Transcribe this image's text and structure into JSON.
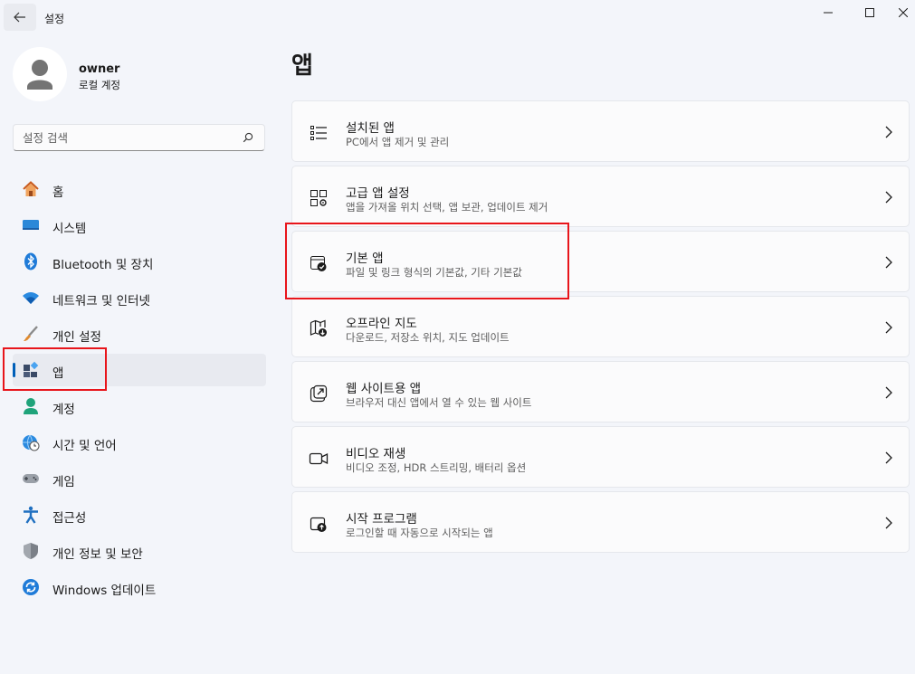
{
  "window": {
    "title": "설정"
  },
  "profile": {
    "name": "owner",
    "account_type": "로컬 계정"
  },
  "search": {
    "placeholder": "설정 검색"
  },
  "sidebar": {
    "items": [
      {
        "label": "홈",
        "icon": "home-icon"
      },
      {
        "label": "시스템",
        "icon": "system-icon"
      },
      {
        "label": "Bluetooth 및 장치",
        "icon": "bluetooth-icon"
      },
      {
        "label": "네트워크 및 인터넷",
        "icon": "wifi-icon"
      },
      {
        "label": "개인 설정",
        "icon": "brush-icon"
      },
      {
        "label": "앱",
        "icon": "apps-icon",
        "selected": true
      },
      {
        "label": "계정",
        "icon": "account-icon"
      },
      {
        "label": "시간 및 언어",
        "icon": "globe-clock-icon"
      },
      {
        "label": "게임",
        "icon": "gamepad-icon"
      },
      {
        "label": "접근성",
        "icon": "accessibility-icon"
      },
      {
        "label": "개인 정보 및 보안",
        "icon": "shield-icon"
      },
      {
        "label": "Windows 업데이트",
        "icon": "update-icon"
      }
    ]
  },
  "main": {
    "title": "앱",
    "cards": [
      {
        "title": "설치된 앱",
        "subtitle": "PC에서 앱 제거 및 관리",
        "icon": "list-icon"
      },
      {
        "title": "고급 앱 설정",
        "subtitle": "앱을 가져올 위치 선택, 앱 보관, 업데이트 제거",
        "icon": "advanced-apps-icon"
      },
      {
        "title": "기본 앱",
        "subtitle": "파일 및 링크 형식의 기본값, 기타 기본값",
        "icon": "default-apps-icon"
      },
      {
        "title": "오프라인 지도",
        "subtitle": "다운로드, 저장소 위치, 지도 업데이트",
        "icon": "offline-map-icon"
      },
      {
        "title": "웹 사이트용 앱",
        "subtitle": "브라우저 대신 앱에서 열 수 있는 웹 사이트",
        "icon": "web-app-icon"
      },
      {
        "title": "비디오 재생",
        "subtitle": "비디오 조정, HDR 스트리밍, 배터리 옵션",
        "icon": "video-icon"
      },
      {
        "title": "시작 프로그램",
        "subtitle": "로그인할 때 자동으로 시작되는 앱",
        "icon": "startup-icon"
      }
    ]
  },
  "colors": {
    "accent": "#005fb8",
    "highlight": "#e8151b",
    "background": "#f3f5fa"
  }
}
